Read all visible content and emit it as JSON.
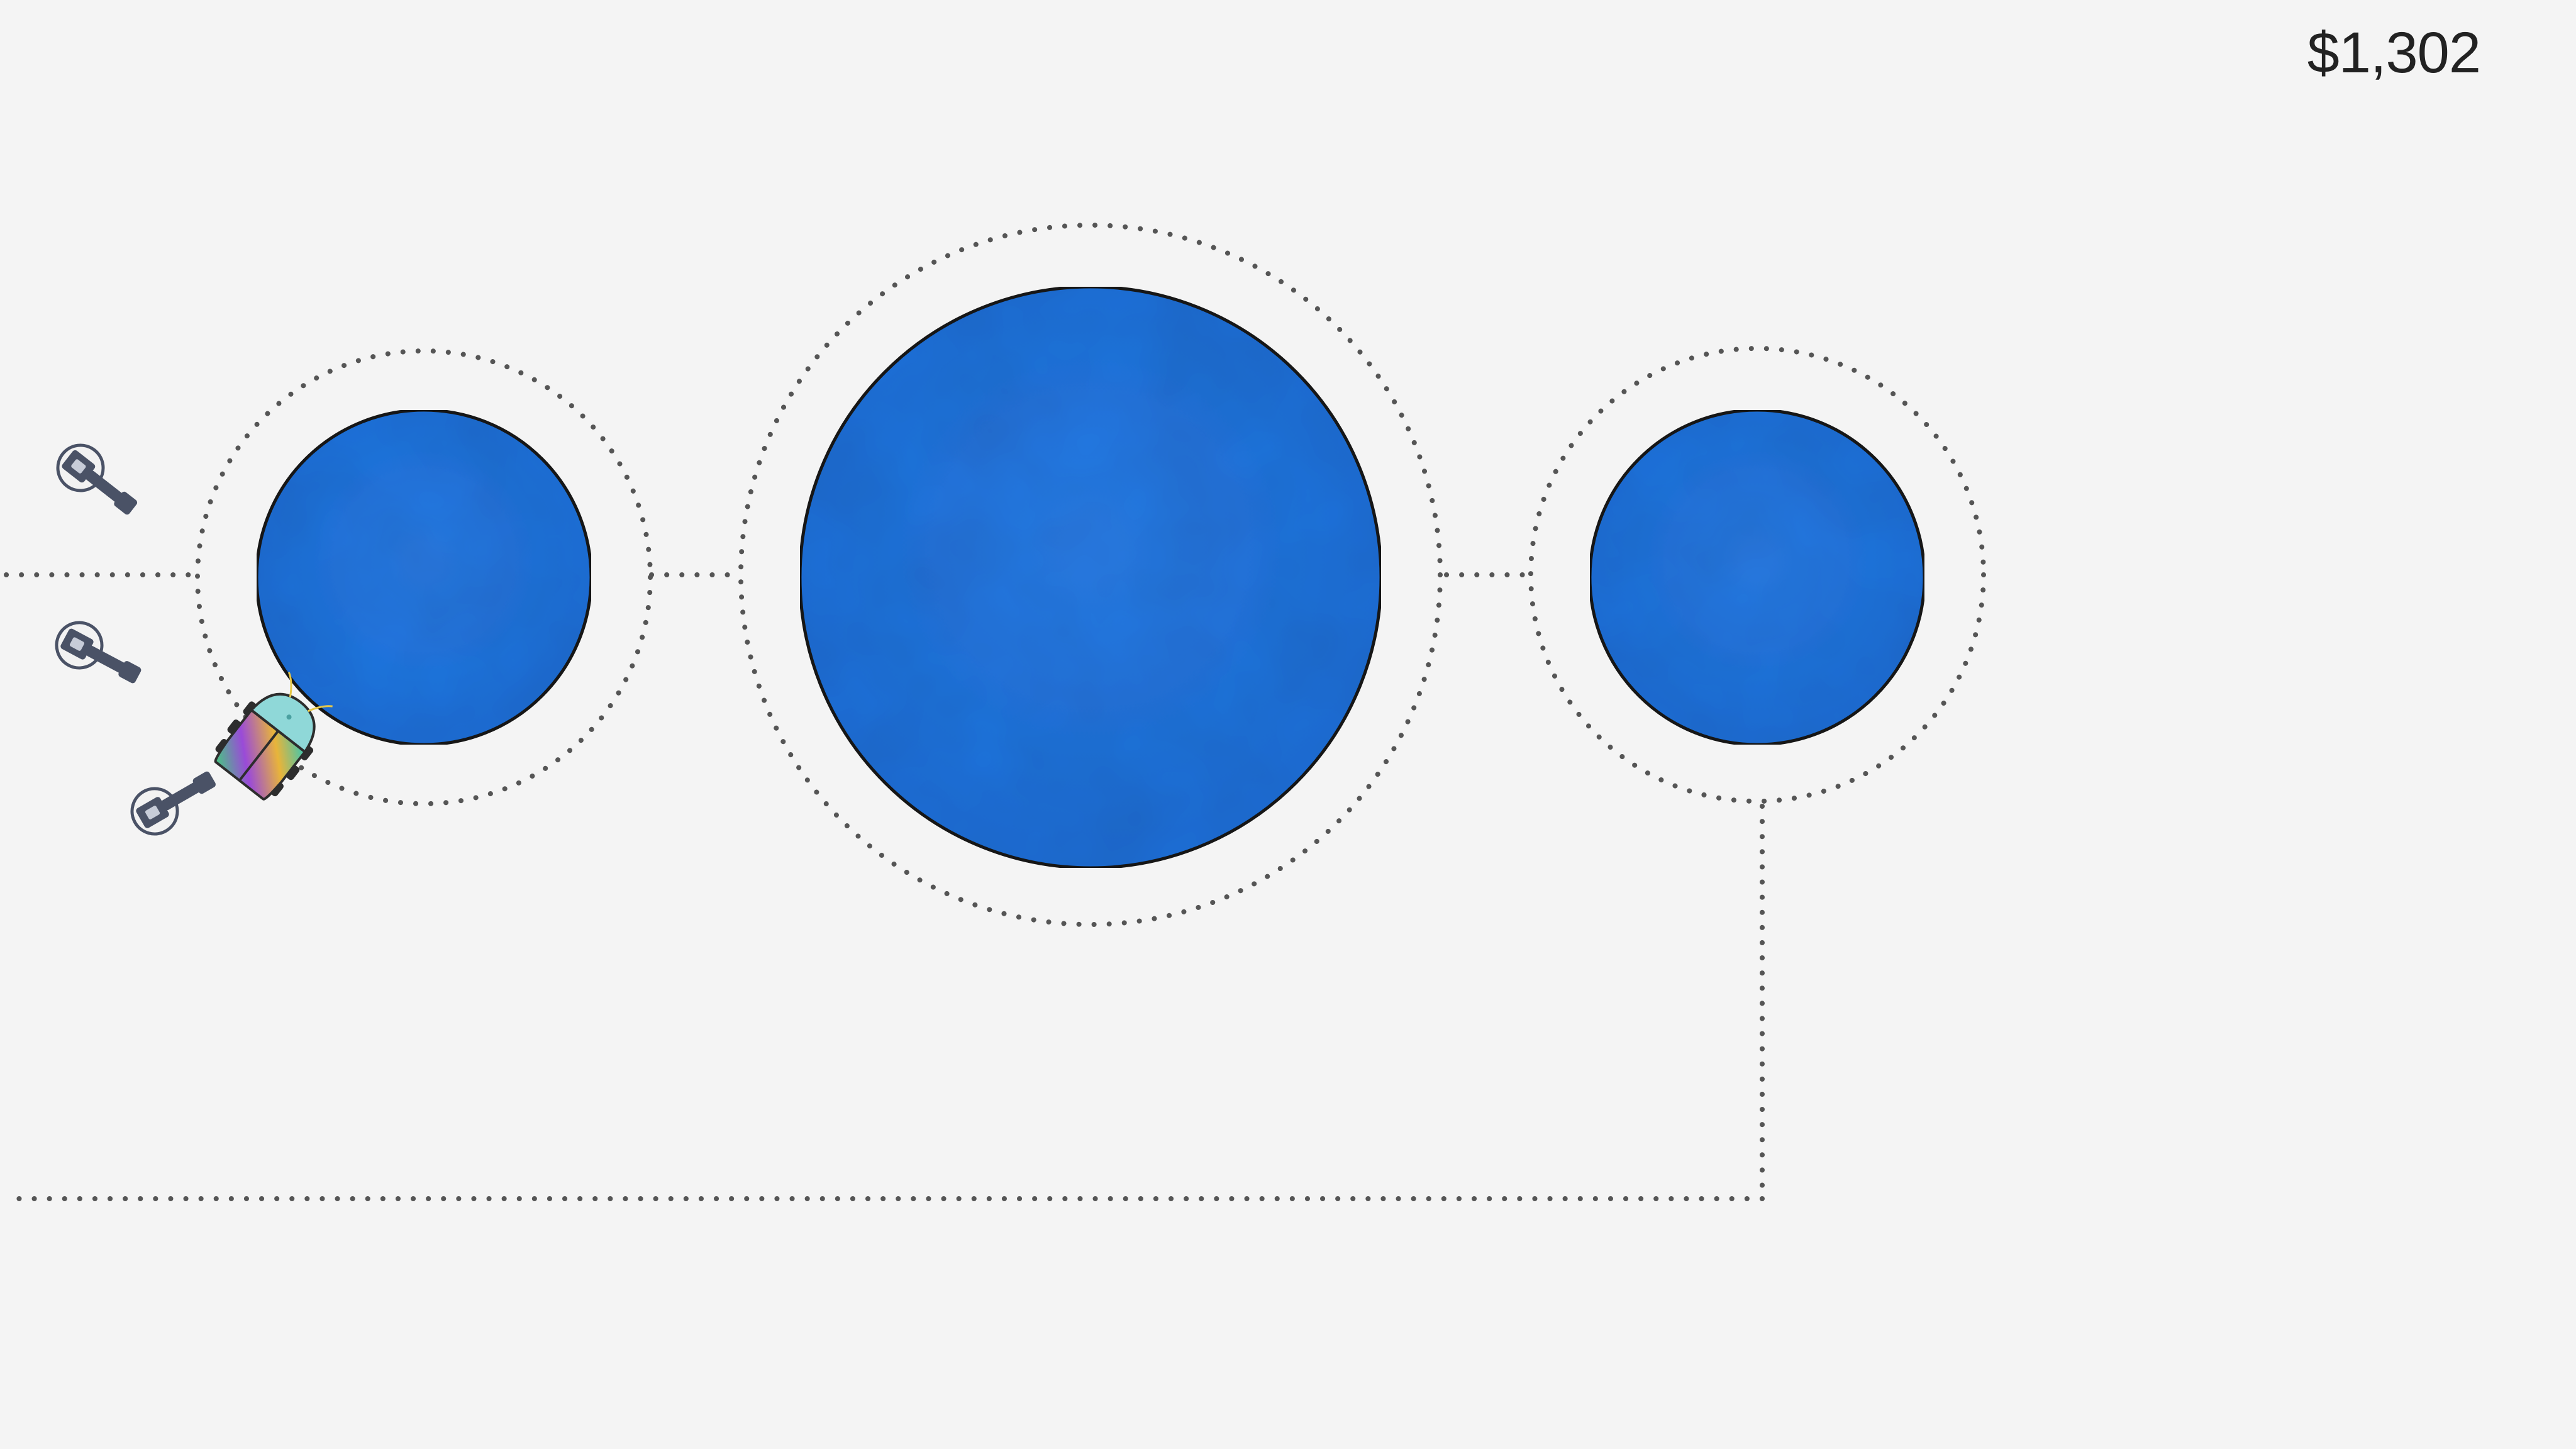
{
  "hud": {
    "money": "$1,302"
  },
  "colors": {
    "background": "#f4f4f4",
    "pond_fill": "#2476e0",
    "path_dots": "#555555",
    "turret_body": "#4a5266"
  },
  "scene": {
    "pond_count": 3,
    "turret_count": 3,
    "enemy_count": 1,
    "pond_icon": "crumpled-blue-circle",
    "turret_icon": "gun-turret-icon",
    "enemy_icon": "beetle-bug-icon"
  }
}
